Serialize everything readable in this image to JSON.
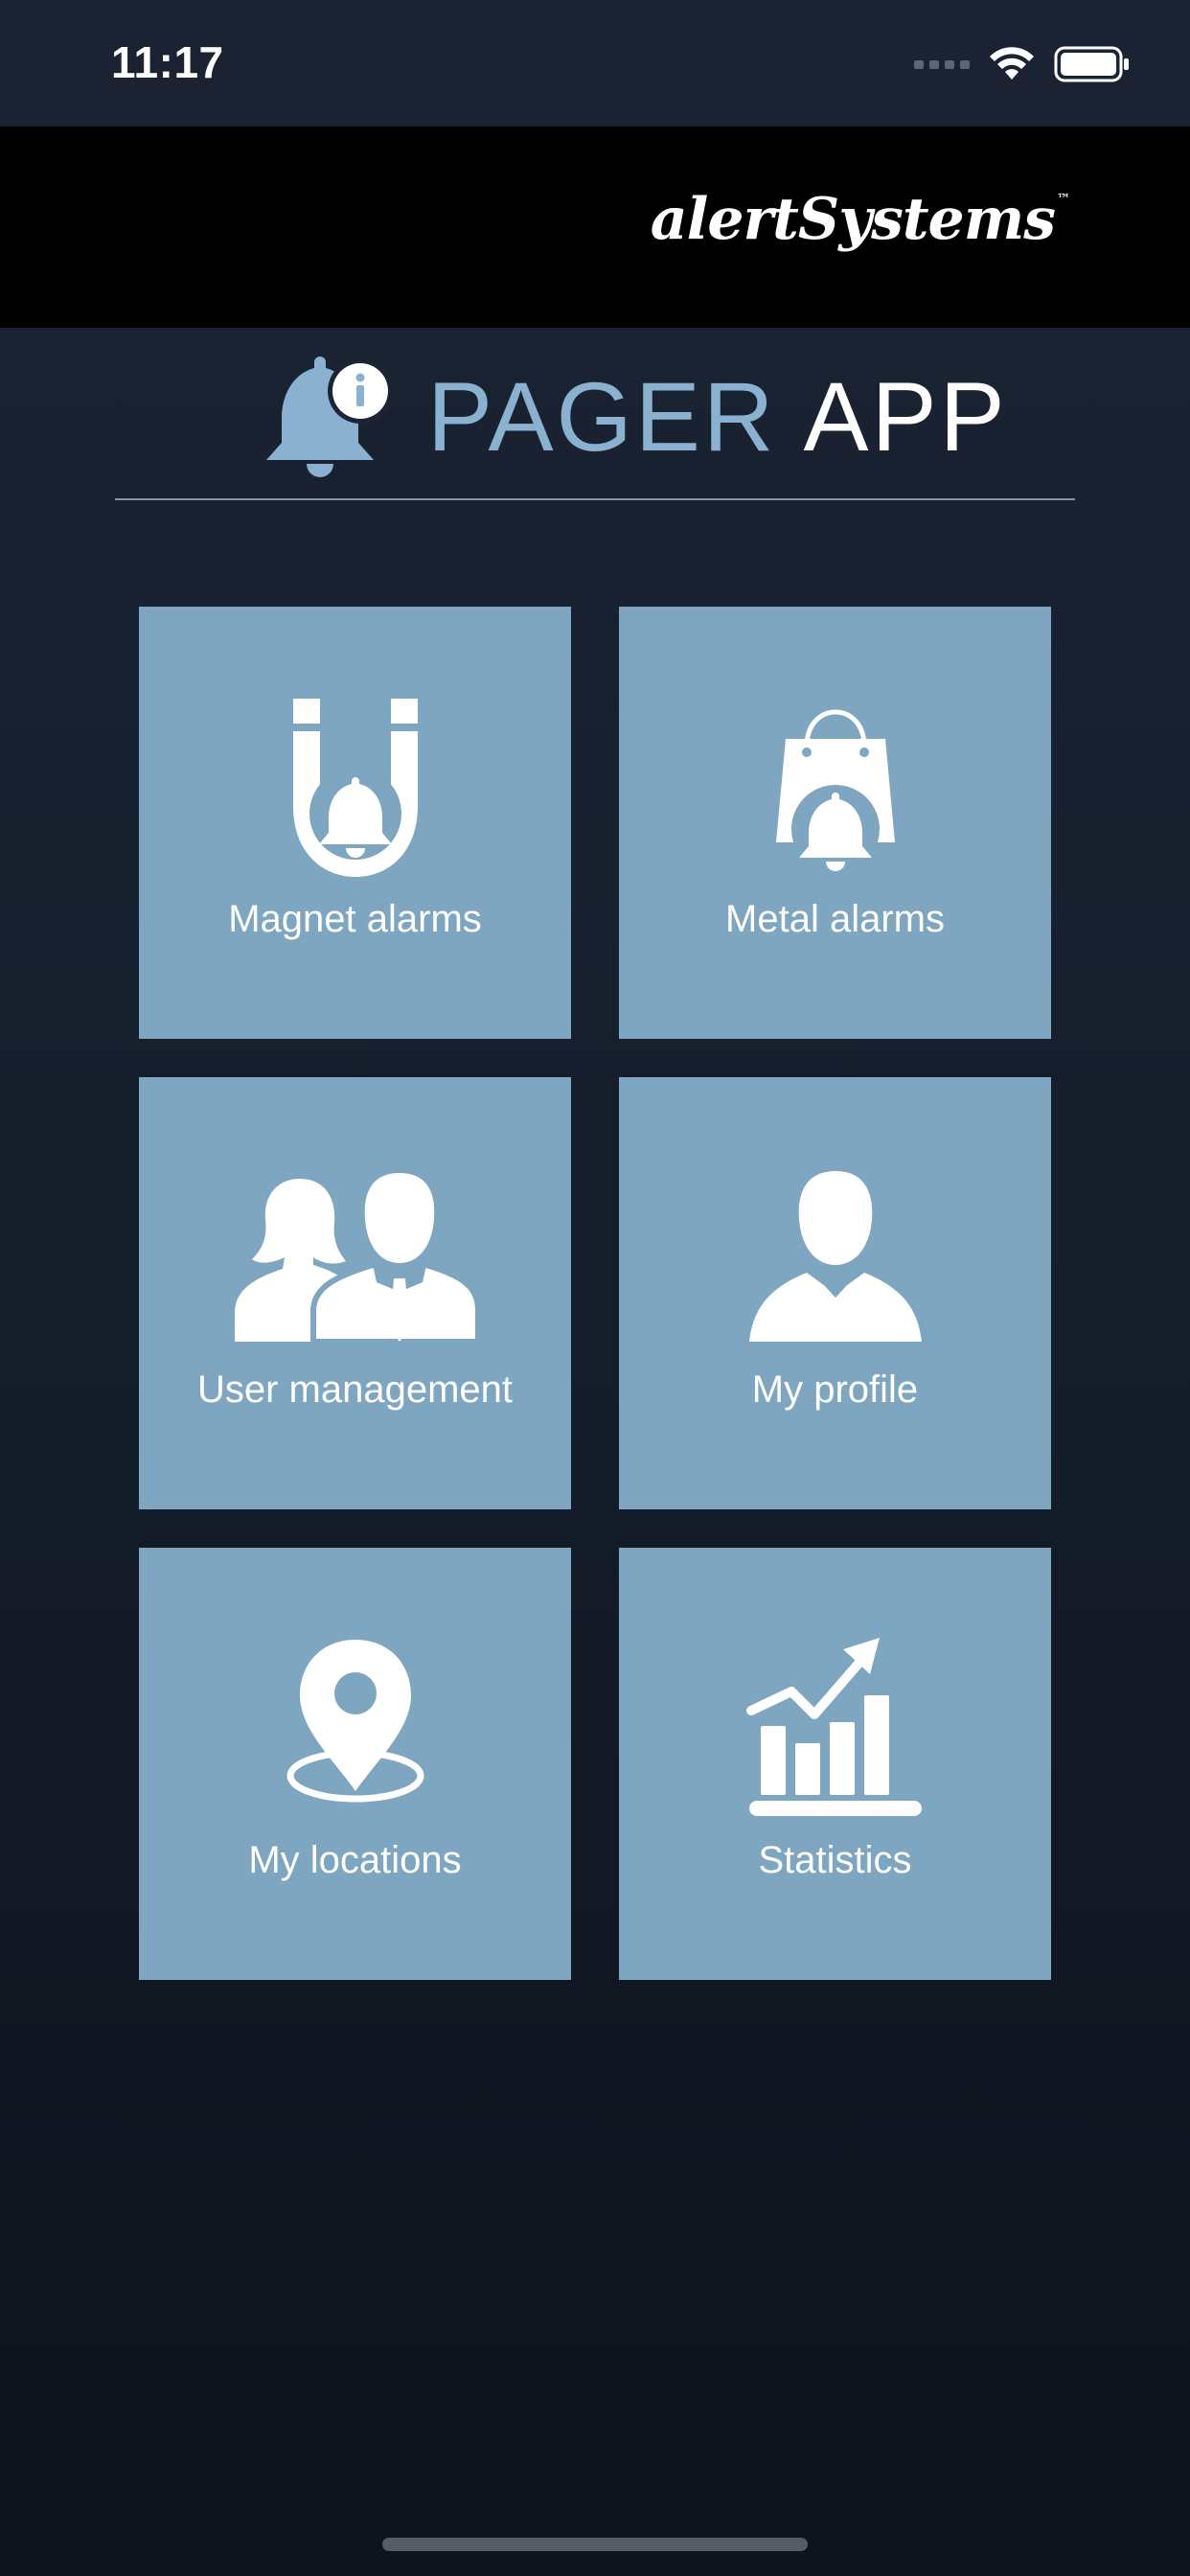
{
  "status_bar": {
    "time": "11:17",
    "icons": [
      "cellular-dots-icon",
      "wifi-icon",
      "battery-icon"
    ]
  },
  "brand": {
    "logo_text": "alertSystems",
    "trademark": "™"
  },
  "app_header": {
    "title_part1": "PAGER",
    "title_part2": "APP",
    "icon": "bell-info-icon"
  },
  "tiles": [
    {
      "label": "Magnet alarms",
      "icon": "magnet-bell-icon"
    },
    {
      "label": "Metal alarms",
      "icon": "bag-bell-icon"
    },
    {
      "label": "User management",
      "icon": "users-icon"
    },
    {
      "label": "My profile",
      "icon": "person-icon"
    },
    {
      "label": "My locations",
      "icon": "location-pin-icon"
    },
    {
      "label": "Statistics",
      "icon": "statistics-chart-icon"
    }
  ],
  "colors": {
    "tile_background": "#7ea6c0",
    "accent_blue": "#8ab2d0",
    "brand_bar": "#000000",
    "background_top": "#1c2535",
    "background_bottom": "#0e131c"
  }
}
